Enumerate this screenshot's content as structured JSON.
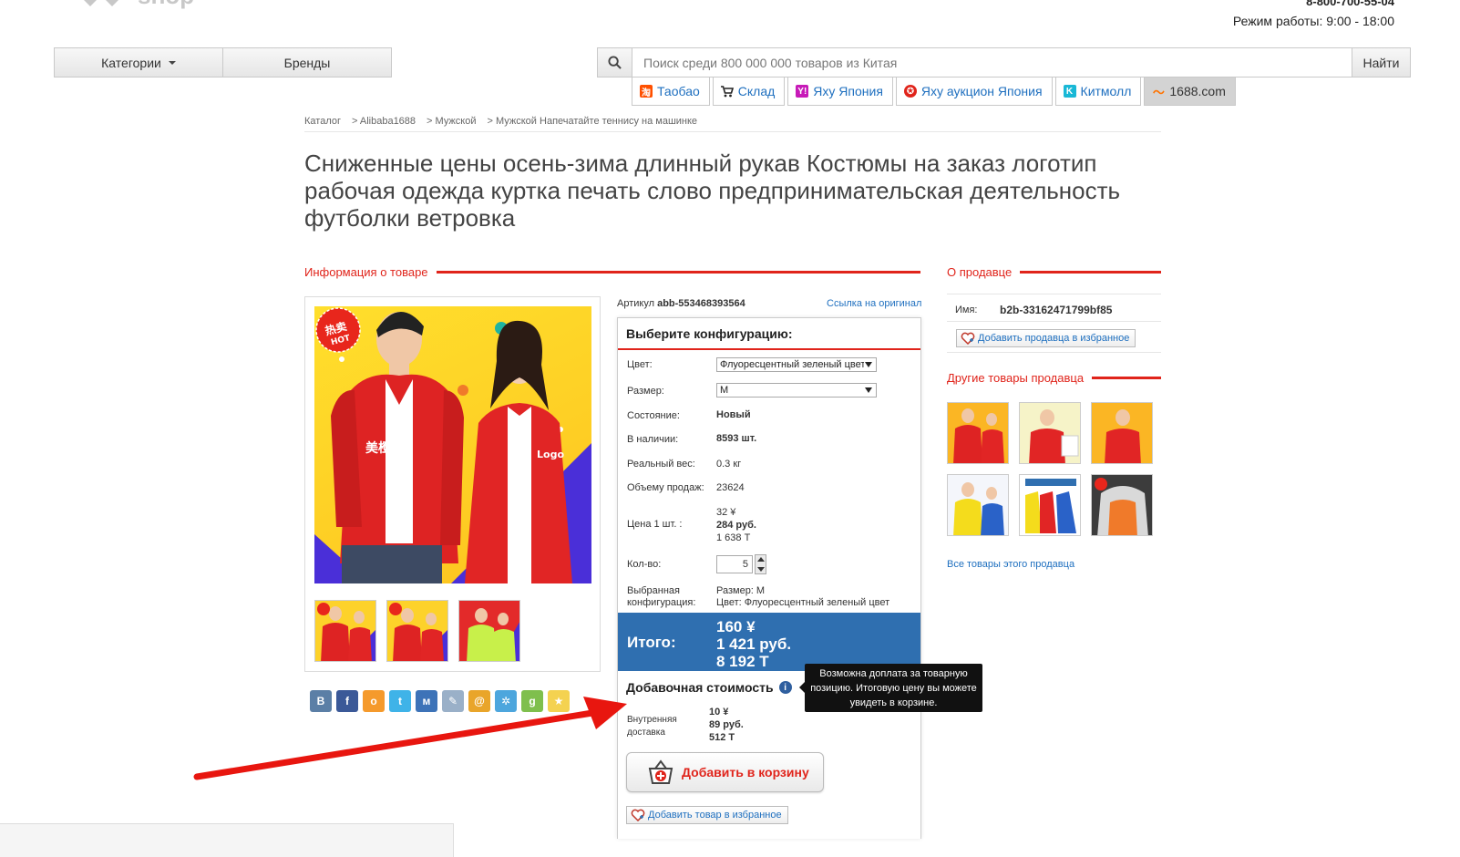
{
  "header": {
    "logo_word": "shop",
    "phone": "8-800-700-55-04",
    "hours": "Режим работы: 9:00 - 18:00"
  },
  "nav": {
    "categories": "Категории",
    "brands": "Бренды"
  },
  "search": {
    "placeholder": "Поиск среди 800 000 000 товаров из Китая",
    "button": "Найти"
  },
  "sources": [
    {
      "label": "Таобао",
      "color": "#ff5000"
    },
    {
      "label": "Склад",
      "color": "#222222"
    },
    {
      "label": "Яху Япония",
      "color": "#c71ab8"
    },
    {
      "label": "Яху аукцион Япония",
      "color": "#e0241b"
    },
    {
      "label": "Китмолл",
      "color": "#19b8d6"
    },
    {
      "label": "1688.com",
      "color": "#ff7300"
    }
  ],
  "breadcrumb": [
    "Каталог",
    "> Alibaba1688",
    "> Мужской",
    "> Мужской Напечатайте теннису на машинке"
  ],
  "title": "Сниженные цены осень-зима длинный рукав Костюмы на заказ логотип рабочая одежда куртка печать слово предпринимательская деятельность футболки ветровка",
  "product_section": "Информация о товаре",
  "seller_section": "О продавце",
  "other_section": "Другие товары продавца",
  "image": {
    "hot_cn": "热卖",
    "hot_en": "HOT",
    "left_print": "美橙",
    "right_print": "Logo"
  },
  "article": {
    "label": "Артикул",
    "value": "abb-553468393564"
  },
  "original_link": "Ссылка на оригинал",
  "config": {
    "heading": "Выберите конфигурацию:",
    "color_label": "Цвет:",
    "color_value": "Флуоресцентный зеленый цвет",
    "size_label": "Размер:",
    "size_value": "M",
    "condition_label": "Состояние:",
    "condition_value": "Новый",
    "stock_label": "В наличии:",
    "stock_value": "8593 шт.",
    "weight_label": "Реальный вес:",
    "weight_value": "0.3 кг",
    "sales_label": "Объему продаж:",
    "sales_value": "23624",
    "price_label": "Цена 1 шт. :",
    "price_cny": "32 ¥",
    "price_rub": "284 руб.",
    "price_kzt": "1 638 Т",
    "qty_label": "Кол-во:",
    "qty_value": "5",
    "chosen_label_1": "Выбранная",
    "chosen_label_2": "конфигурация:",
    "chosen_size": "Размер: M",
    "chosen_color": "Цвет: Флуоресцентный зеленый цвет"
  },
  "total": {
    "label": "Итого:",
    "cny": "160 ¥",
    "rub": "1 421 руб.",
    "kzt": "8 192 Т"
  },
  "extra": {
    "heading": "Добавочная стоимость",
    "tooltip": "Возможна доплата за товарную позицию. Итоговую цену вы можете увидеть в корзине.",
    "delivery_label_1": "Внутренняя",
    "delivery_label_2": "доставка",
    "delivery_cny": "10 ¥",
    "delivery_rub": "89 руб.",
    "delivery_kzt": "512 Т"
  },
  "cart_button": "Добавить в корзину",
  "fav_product": "Добавить товар в избранное",
  "seller": {
    "name_label": "Имя:",
    "name": "b2b-33162471799bf85",
    "fav": "Добавить продавца в избранное",
    "all_link": "Все товары этого продавца"
  },
  "share": [
    {
      "icon": "vk-icon",
      "glyph": "B",
      "color": "#5b7fa6"
    },
    {
      "icon": "facebook-icon",
      "glyph": "f",
      "color": "#3b5998"
    },
    {
      "icon": "odnoklassniki-icon",
      "glyph": "o",
      "color": "#f59a2c"
    },
    {
      "icon": "twitter-icon",
      "glyph": "t",
      "color": "#3fb3e8"
    },
    {
      "icon": "moimir-icon",
      "glyph": "м",
      "color": "#3d73b8"
    },
    {
      "icon": "livejournal-icon",
      "glyph": "✎",
      "color": "#9ab0c8"
    },
    {
      "icon": "mailru-icon",
      "glyph": "@",
      "color": "#e9a52a"
    },
    {
      "icon": "liveinternet-icon",
      "glyph": "✲",
      "color": "#4da6dd"
    },
    {
      "icon": "google-plus-icon",
      "glyph": "g",
      "color": "#7fbf4d"
    },
    {
      "icon": "bookmark-icon",
      "glyph": "★",
      "color": "#f4d250"
    }
  ]
}
